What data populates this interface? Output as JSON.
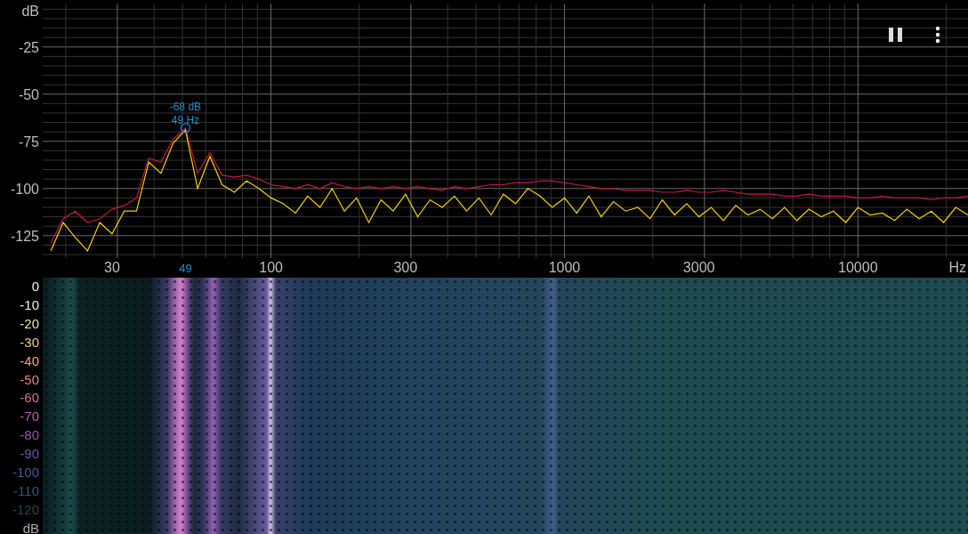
{
  "spectrum": {
    "chart_data": {
      "type": "line",
      "grid": true,
      "xlabel": "Hz",
      "ylabel": "dB",
      "ylim": [
        -135,
        -2
      ],
      "yticks": [
        -25,
        -50,
        -75,
        -100,
        -125
      ],
      "categories": [
        null,
        null,
        null,
        null,
        null,
        "30",
        null,
        null,
        null,
        null,
        null,
        null,
        null,
        null,
        null,
        null,
        null,
        null,
        "100",
        null,
        null,
        null,
        null,
        null,
        null,
        null,
        null,
        null,
        null,
        "300",
        null,
        null,
        null,
        null,
        null,
        null,
        null,
        null,
        null,
        null,
        null,
        null,
        "1000",
        null,
        null,
        null,
        null,
        null,
        null,
        null,
        null,
        null,
        null,
        "3000",
        null,
        null,
        null,
        null,
        null,
        null,
        null,
        null,
        null,
        null,
        null,
        null,
        "10000",
        null,
        null,
        null,
        null,
        null,
        null,
        null,
        null,
        null
      ],
      "series": [
        {
          "color": "#c8183c",
          "values": [
            -129,
            -116,
            -112,
            -118,
            -116,
            -111,
            -109,
            -105,
            -84,
            -86,
            -74,
            -68,
            -92,
            -81,
            -93,
            -94,
            -93,
            -95,
            -98,
            -99,
            -100,
            -98,
            -100,
            -97,
            -99,
            -100,
            -99,
            -100,
            -99,
            -100,
            -99,
            -100,
            -101,
            -99,
            -100,
            -99,
            -98,
            -98,
            -97,
            -97,
            -96,
            -96,
            -97,
            -98,
            -99,
            -100,
            -100,
            -101,
            -101,
            -101,
            -102,
            -102,
            -101,
            -102,
            -102,
            -101,
            -102,
            -103,
            -103,
            -103,
            -104,
            -104,
            -103,
            -104,
            -104,
            -104,
            -105,
            -105,
            -104,
            -105,
            -105,
            -105,
            -106,
            -105,
            -105,
            -104
          ]
        },
        {
          "color": "#f2d000",
          "values": [
            -133,
            -118,
            -126,
            -133,
            -118,
            -124,
            -112,
            -112,
            -86,
            -92,
            -76,
            -69,
            -100,
            -83,
            -98,
            -102,
            -96,
            -100,
            -105,
            -108,
            -113,
            -104,
            -110,
            -100,
            -112,
            -105,
            -118,
            -106,
            -112,
            -103,
            -115,
            -106,
            -110,
            -104,
            -112,
            -105,
            -114,
            -103,
            -108,
            -100,
            -104,
            -110,
            -105,
            -113,
            -104,
            -115,
            -107,
            -112,
            -110,
            -116,
            -106,
            -114,
            -108,
            -115,
            -110,
            -117,
            -109,
            -114,
            -111,
            -116,
            -110,
            -117,
            -111,
            -115,
            -112,
            -118,
            -110,
            -114,
            -113,
            -117,
            -111,
            -116,
            -112,
            -118,
            -110,
            -114
          ]
        }
      ]
    },
    "peak_marker": {
      "level_text": "-68 dB",
      "frequency_text": "49 Hz",
      "axis_label": "49"
    }
  },
  "spectrogram": {
    "scale_labels": [
      {
        "text": "0",
        "color": "#f2f2f2"
      },
      {
        "text": "-10",
        "color": "#eef2cf"
      },
      {
        "text": "-20",
        "color": "#ece3a6"
      },
      {
        "text": "-30",
        "color": "#ecc98f"
      },
      {
        "text": "-40",
        "color": "#eaa685"
      },
      {
        "text": "-50",
        "color": "#e2838a"
      },
      {
        "text": "-60",
        "color": "#d46fa2"
      },
      {
        "text": "-70",
        "color": "#b65fae"
      },
      {
        "text": "-80",
        "color": "#9256b2"
      },
      {
        "text": "-90",
        "color": "#6c56aa"
      },
      {
        "text": "-100",
        "color": "#435a92"
      },
      {
        "text": "-110",
        "color": "#2c5670"
      },
      {
        "text": "-120",
        "color": "#1f4a4c"
      }
    ],
    "unit": "dB"
  }
}
